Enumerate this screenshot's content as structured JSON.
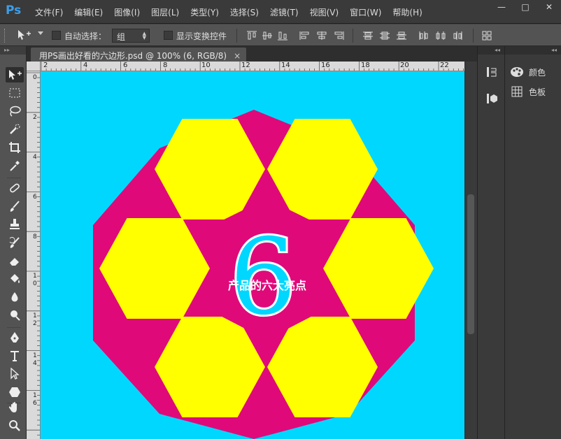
{
  "app": {
    "logo": "Ps"
  },
  "menu": [
    "文件(F)",
    "编辑(E)",
    "图像(I)",
    "图层(L)",
    "类型(Y)",
    "选择(S)",
    "滤镜(T)",
    "视图(V)",
    "窗口(W)",
    "帮助(H)"
  ],
  "window_controls": {
    "minimize": "—",
    "maximize": "□",
    "close": "✕"
  },
  "options": {
    "auto_select_label": "自动选择：",
    "auto_select_value": "组",
    "show_transform_label": "显示变换控件"
  },
  "document": {
    "tab_title": "用PS画出好看的六边形.psd @ 100% (6, RGB/8)",
    "close_glyph": "×"
  },
  "ruler_h": [
    "2",
    "4",
    "6",
    "8",
    "10",
    "12",
    "14",
    "16",
    "18",
    "20",
    "22"
  ],
  "ruler_v": [
    "0",
    "2",
    "4",
    "6",
    "8",
    "10",
    "12",
    "14",
    "16"
  ],
  "canvas": {
    "big_number": "6",
    "caption": "产品的六大亮点",
    "colors": {
      "background": "#00d7ff",
      "magenta": "#e0097a",
      "yellow": "#ffff00"
    }
  },
  "panels": {
    "color_label": "颜色",
    "swatches_label": "色板"
  },
  "icons": {
    "move": "move-tool-icon",
    "marquee": "rect-marquee-icon",
    "lasso": "lasso-icon",
    "quick_select": "quick-select-icon",
    "crop": "crop-icon",
    "eyedropper": "eyedropper-icon",
    "heal": "healing-brush-icon",
    "brush": "brush-icon",
    "stamp": "clone-stamp-icon",
    "history_brush": "history-brush-icon",
    "eraser": "eraser-icon",
    "bucket": "paint-bucket-icon",
    "blur": "blur-icon",
    "dodge": "dodge-icon",
    "pen": "pen-icon",
    "type": "type-icon",
    "path_select": "path-select-icon",
    "shape": "hexagon-shape-icon",
    "hand": "hand-icon",
    "zoom": "zoom-icon"
  }
}
